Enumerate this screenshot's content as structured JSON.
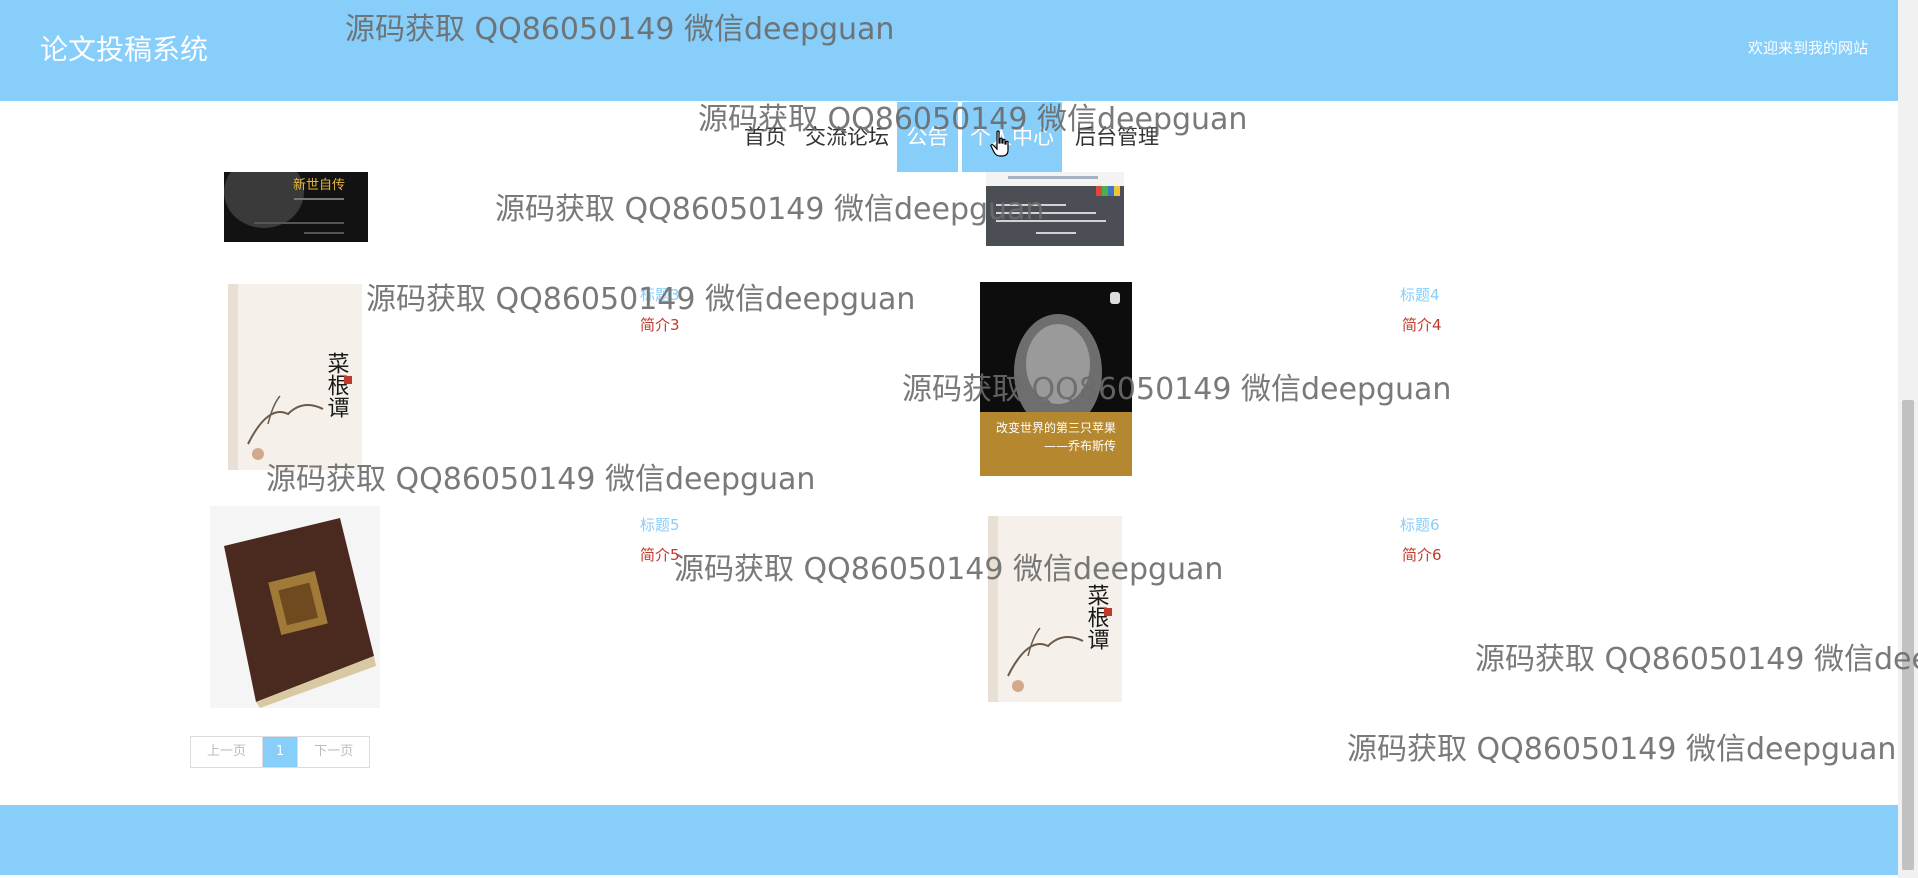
{
  "header": {
    "site_title": "论文投稿系统",
    "welcome": "欢迎来到我的网站"
  },
  "nav": {
    "items": [
      {
        "label": "首页",
        "active": false
      },
      {
        "label": "交流论坛",
        "active": false
      },
      {
        "label": "公告",
        "active": true
      },
      {
        "label": "个人中心",
        "active": true
      },
      {
        "label": "后台管理",
        "active": false
      }
    ]
  },
  "books": [
    {
      "title": "标题3",
      "desc": "简介3",
      "cover": "book-cover-caigentan"
    },
    {
      "title": "标题4",
      "desc": "简介4",
      "cover": "book-cover-steve-jobs"
    },
    {
      "title": "标题5",
      "desc": "简介5",
      "cover": "book-cover-leather-journal"
    },
    {
      "title": "标题6",
      "desc": "简介6",
      "cover": "book-cover-caigentan"
    }
  ],
  "pagination": {
    "prev": "上一页",
    "current": "1",
    "next": "下一页"
  },
  "watermark": {
    "text": "源码获取 QQ86050149 微信deepguan",
    "text_cut": "源码获取 QQ86050149 微信dee"
  },
  "covers": {
    "book_top_left_title": "新世自传",
    "jobs_subtitle": "改变世界的第三只苹果",
    "jobs_author": "——乔布斯传",
    "caigentan_title": "菜根谭"
  },
  "colors": {
    "brand": "#87cefa",
    "desc_red": "#c0392b"
  }
}
